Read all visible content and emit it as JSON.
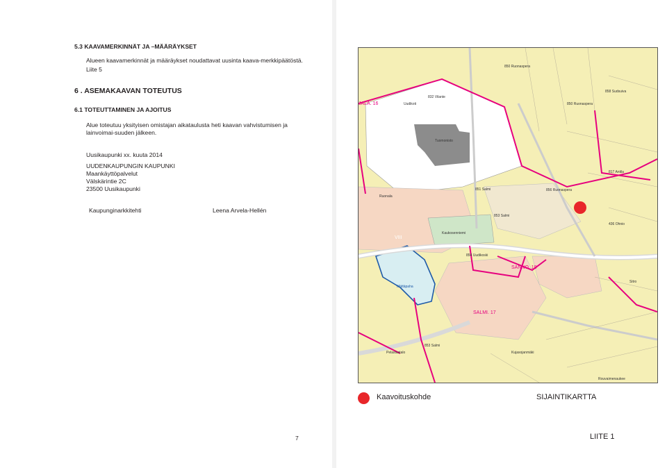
{
  "left_page": {
    "section_heading": "5.3    KAAVAMERKINNÄT JA –MÄÄRÄYKSET",
    "section_text": "Alueen kaavamerkinnät ja    määräykset noudattavat uusinta kaava-merkkipäätöstä.",
    "appendix_ref": "Liite  5",
    "chapter_heading": "6 .    ASEMAKAAVAN    TOTEUTUS",
    "subsection_heading": "6.1     TOTEUTTAMINEN JA AJOITUS",
    "subsection_text": "Alue toteutuu yksityisen omistajan aikataulusta heti kaavan vahvistumisen ja lainvoimai-suuden jälkeen.",
    "place_date": "Uusikaupunki xx.   kuuta 2014",
    "address_lines": [
      "UUDENKAUPUNGIN KAUPUNKI",
      "Maankäyttöpalvelut",
      "Välskärintie 2C",
      "23500 Uusikaupunki"
    ],
    "signer_title": "Kaupunginarkkitehti",
    "signer_name": "Leena Arvela-Hellén",
    "page_number": "7"
  },
  "right_page": {
    "map_labels": [
      "850 Ruonaspera",
      "JALA. 16",
      "832 Vilante",
      "Uudikoti",
      "858 Sudsuiva",
      "850 Ruonaspera",
      "Tuomonisto",
      "Ruonala",
      "851 Salmi",
      "856 Ruonaspera",
      "817 Antila",
      "853 Salmi",
      "436 Ohnio",
      "Kaukosenniemi",
      "VIII",
      "854 Uudikoski",
      "Mättäpaha",
      "SANNO. 18",
      "SALMI. 17",
      "853 Salmi",
      "Pelastustalo",
      "Kujasojanmäki",
      "Rouvaimenaukee",
      "Sitro"
    ],
    "legend_label": "Kaavoituskohde",
    "map_title": "SIJAINTIKARTTA",
    "appendix_label": "LIITE 1"
  },
  "colors": {
    "map_base": "#f5efb6",
    "map_road": "#d9d9d9",
    "map_red": "#e8262a",
    "plan_boundary": "#e6007e",
    "water": "#1e5aa8",
    "water_fill": "#d8eef2"
  }
}
